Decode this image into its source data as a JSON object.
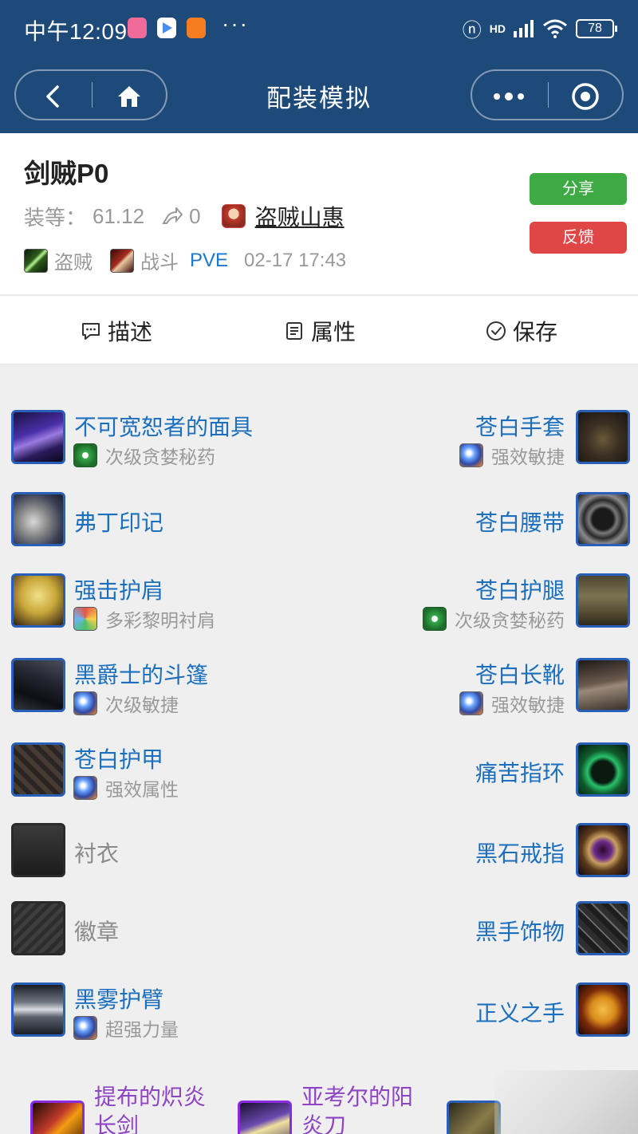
{
  "status_bar": {
    "time": "中午12:09",
    "dots": "···",
    "signal": "HD",
    "battery": "78"
  },
  "nav": {
    "title": "配装模拟"
  },
  "build": {
    "title": "剑贼P0",
    "gear_level_label": "装等：",
    "gear_level": "61.12",
    "shares": "0",
    "author": "盗贼山惠",
    "class_name": "盗贼",
    "spec_name": "战斗",
    "mode": "PVE",
    "date": "02-17 17:43"
  },
  "buttons": {
    "share": "分享",
    "feedback": "反馈"
  },
  "tabs": [
    {
      "label": "描述",
      "icon": "chat-icon"
    },
    {
      "label": "属性",
      "icon": "list-icon"
    },
    {
      "label": "保存",
      "icon": "check-circle-icon"
    }
  ],
  "left_slots": [
    {
      "name": "不可宽恕者的面具",
      "enchant": "次级贪婪秘药",
      "enchant_color": "green"
    },
    {
      "name": "弗丁印记",
      "enchant": ""
    },
    {
      "name": "强击护肩",
      "enchant": "多彩黎明衬肩",
      "enchant_color": "prism"
    },
    {
      "name": "黑爵士的斗篷",
      "enchant": "次级敏捷",
      "enchant_color": "blue"
    },
    {
      "name": "苍白护甲",
      "enchant": "强效属性",
      "enchant_color": "blue"
    },
    {
      "name": "衬衣",
      "enchant": "",
      "empty": true
    },
    {
      "name": "徽章",
      "enchant": "",
      "empty": true
    },
    {
      "name": "黑雾护臂",
      "enchant": "超强力量",
      "enchant_color": "blue"
    }
  ],
  "right_slots": [
    {
      "name": "苍白手套",
      "enchant": "强效敏捷",
      "enchant_color": "blue"
    },
    {
      "name": "苍白腰带",
      "enchant": ""
    },
    {
      "name": "苍白护腿",
      "enchant": "次级贪婪秘药",
      "enchant_color": "green"
    },
    {
      "name": "苍白长靴",
      "enchant": "强效敏捷",
      "enchant_color": "blue"
    },
    {
      "name": "痛苦指环",
      "enchant": ""
    },
    {
      "name": "黑石戒指",
      "enchant": ""
    },
    {
      "name": "黑手饰物",
      "enchant": ""
    },
    {
      "name": "正义之手",
      "enchant": ""
    }
  ],
  "weapons": [
    {
      "name": "提布的炽炎长剑"
    },
    {
      "name": "亚考尔的阳炎刀"
    }
  ]
}
